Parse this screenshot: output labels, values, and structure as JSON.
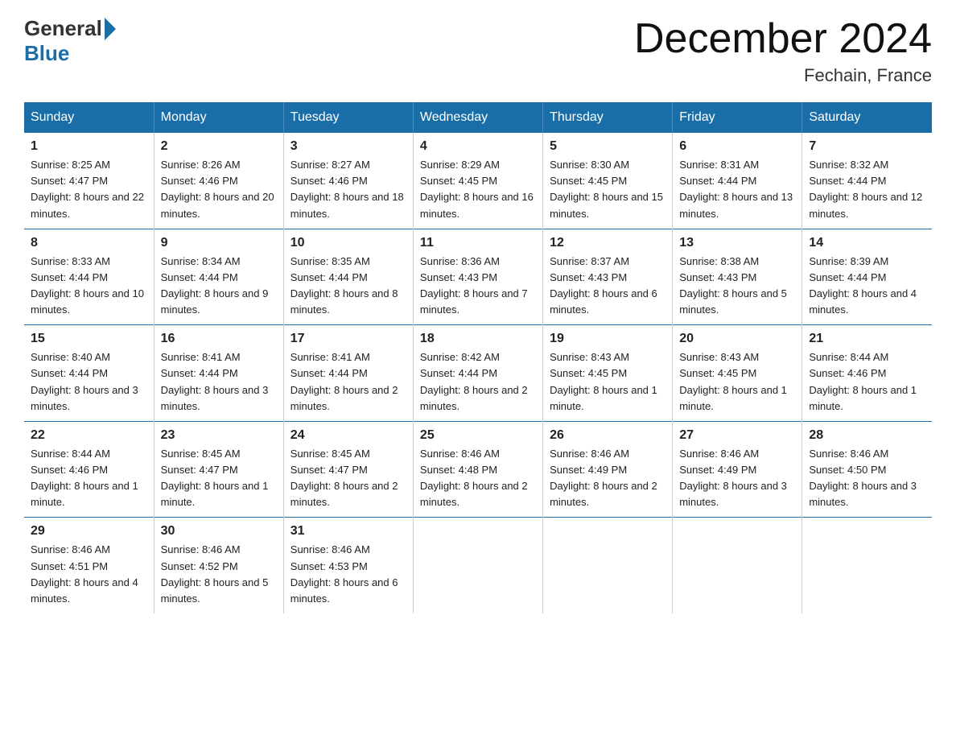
{
  "header": {
    "logo_general": "General",
    "logo_blue": "Blue",
    "main_title": "December 2024",
    "subtitle": "Fechain, France"
  },
  "weekdays": [
    "Sunday",
    "Monday",
    "Tuesday",
    "Wednesday",
    "Thursday",
    "Friday",
    "Saturday"
  ],
  "weeks": [
    [
      {
        "day": "1",
        "sunrise": "8:25 AM",
        "sunset": "4:47 PM",
        "daylight": "8 hours and 22 minutes."
      },
      {
        "day": "2",
        "sunrise": "8:26 AM",
        "sunset": "4:46 PM",
        "daylight": "8 hours and 20 minutes."
      },
      {
        "day": "3",
        "sunrise": "8:27 AM",
        "sunset": "4:46 PM",
        "daylight": "8 hours and 18 minutes."
      },
      {
        "day": "4",
        "sunrise": "8:29 AM",
        "sunset": "4:45 PM",
        "daylight": "8 hours and 16 minutes."
      },
      {
        "day": "5",
        "sunrise": "8:30 AM",
        "sunset": "4:45 PM",
        "daylight": "8 hours and 15 minutes."
      },
      {
        "day": "6",
        "sunrise": "8:31 AM",
        "sunset": "4:44 PM",
        "daylight": "8 hours and 13 minutes."
      },
      {
        "day": "7",
        "sunrise": "8:32 AM",
        "sunset": "4:44 PM",
        "daylight": "8 hours and 12 minutes."
      }
    ],
    [
      {
        "day": "8",
        "sunrise": "8:33 AM",
        "sunset": "4:44 PM",
        "daylight": "8 hours and 10 minutes."
      },
      {
        "day": "9",
        "sunrise": "8:34 AM",
        "sunset": "4:44 PM",
        "daylight": "8 hours and 9 minutes."
      },
      {
        "day": "10",
        "sunrise": "8:35 AM",
        "sunset": "4:44 PM",
        "daylight": "8 hours and 8 minutes."
      },
      {
        "day": "11",
        "sunrise": "8:36 AM",
        "sunset": "4:43 PM",
        "daylight": "8 hours and 7 minutes."
      },
      {
        "day": "12",
        "sunrise": "8:37 AM",
        "sunset": "4:43 PM",
        "daylight": "8 hours and 6 minutes."
      },
      {
        "day": "13",
        "sunrise": "8:38 AM",
        "sunset": "4:43 PM",
        "daylight": "8 hours and 5 minutes."
      },
      {
        "day": "14",
        "sunrise": "8:39 AM",
        "sunset": "4:44 PM",
        "daylight": "8 hours and 4 minutes."
      }
    ],
    [
      {
        "day": "15",
        "sunrise": "8:40 AM",
        "sunset": "4:44 PM",
        "daylight": "8 hours and 3 minutes."
      },
      {
        "day": "16",
        "sunrise": "8:41 AM",
        "sunset": "4:44 PM",
        "daylight": "8 hours and 3 minutes."
      },
      {
        "day": "17",
        "sunrise": "8:41 AM",
        "sunset": "4:44 PM",
        "daylight": "8 hours and 2 minutes."
      },
      {
        "day": "18",
        "sunrise": "8:42 AM",
        "sunset": "4:44 PM",
        "daylight": "8 hours and 2 minutes."
      },
      {
        "day": "19",
        "sunrise": "8:43 AM",
        "sunset": "4:45 PM",
        "daylight": "8 hours and 1 minute."
      },
      {
        "day": "20",
        "sunrise": "8:43 AM",
        "sunset": "4:45 PM",
        "daylight": "8 hours and 1 minute."
      },
      {
        "day": "21",
        "sunrise": "8:44 AM",
        "sunset": "4:46 PM",
        "daylight": "8 hours and 1 minute."
      }
    ],
    [
      {
        "day": "22",
        "sunrise": "8:44 AM",
        "sunset": "4:46 PM",
        "daylight": "8 hours and 1 minute."
      },
      {
        "day": "23",
        "sunrise": "8:45 AM",
        "sunset": "4:47 PM",
        "daylight": "8 hours and 1 minute."
      },
      {
        "day": "24",
        "sunrise": "8:45 AM",
        "sunset": "4:47 PM",
        "daylight": "8 hours and 2 minutes."
      },
      {
        "day": "25",
        "sunrise": "8:46 AM",
        "sunset": "4:48 PM",
        "daylight": "8 hours and 2 minutes."
      },
      {
        "day": "26",
        "sunrise": "8:46 AM",
        "sunset": "4:49 PM",
        "daylight": "8 hours and 2 minutes."
      },
      {
        "day": "27",
        "sunrise": "8:46 AM",
        "sunset": "4:49 PM",
        "daylight": "8 hours and 3 minutes."
      },
      {
        "day": "28",
        "sunrise": "8:46 AM",
        "sunset": "4:50 PM",
        "daylight": "8 hours and 3 minutes."
      }
    ],
    [
      {
        "day": "29",
        "sunrise": "8:46 AM",
        "sunset": "4:51 PM",
        "daylight": "8 hours and 4 minutes."
      },
      {
        "day": "30",
        "sunrise": "8:46 AM",
        "sunset": "4:52 PM",
        "daylight": "8 hours and 5 minutes."
      },
      {
        "day": "31",
        "sunrise": "8:46 AM",
        "sunset": "4:53 PM",
        "daylight": "8 hours and 6 minutes."
      },
      null,
      null,
      null,
      null
    ]
  ]
}
